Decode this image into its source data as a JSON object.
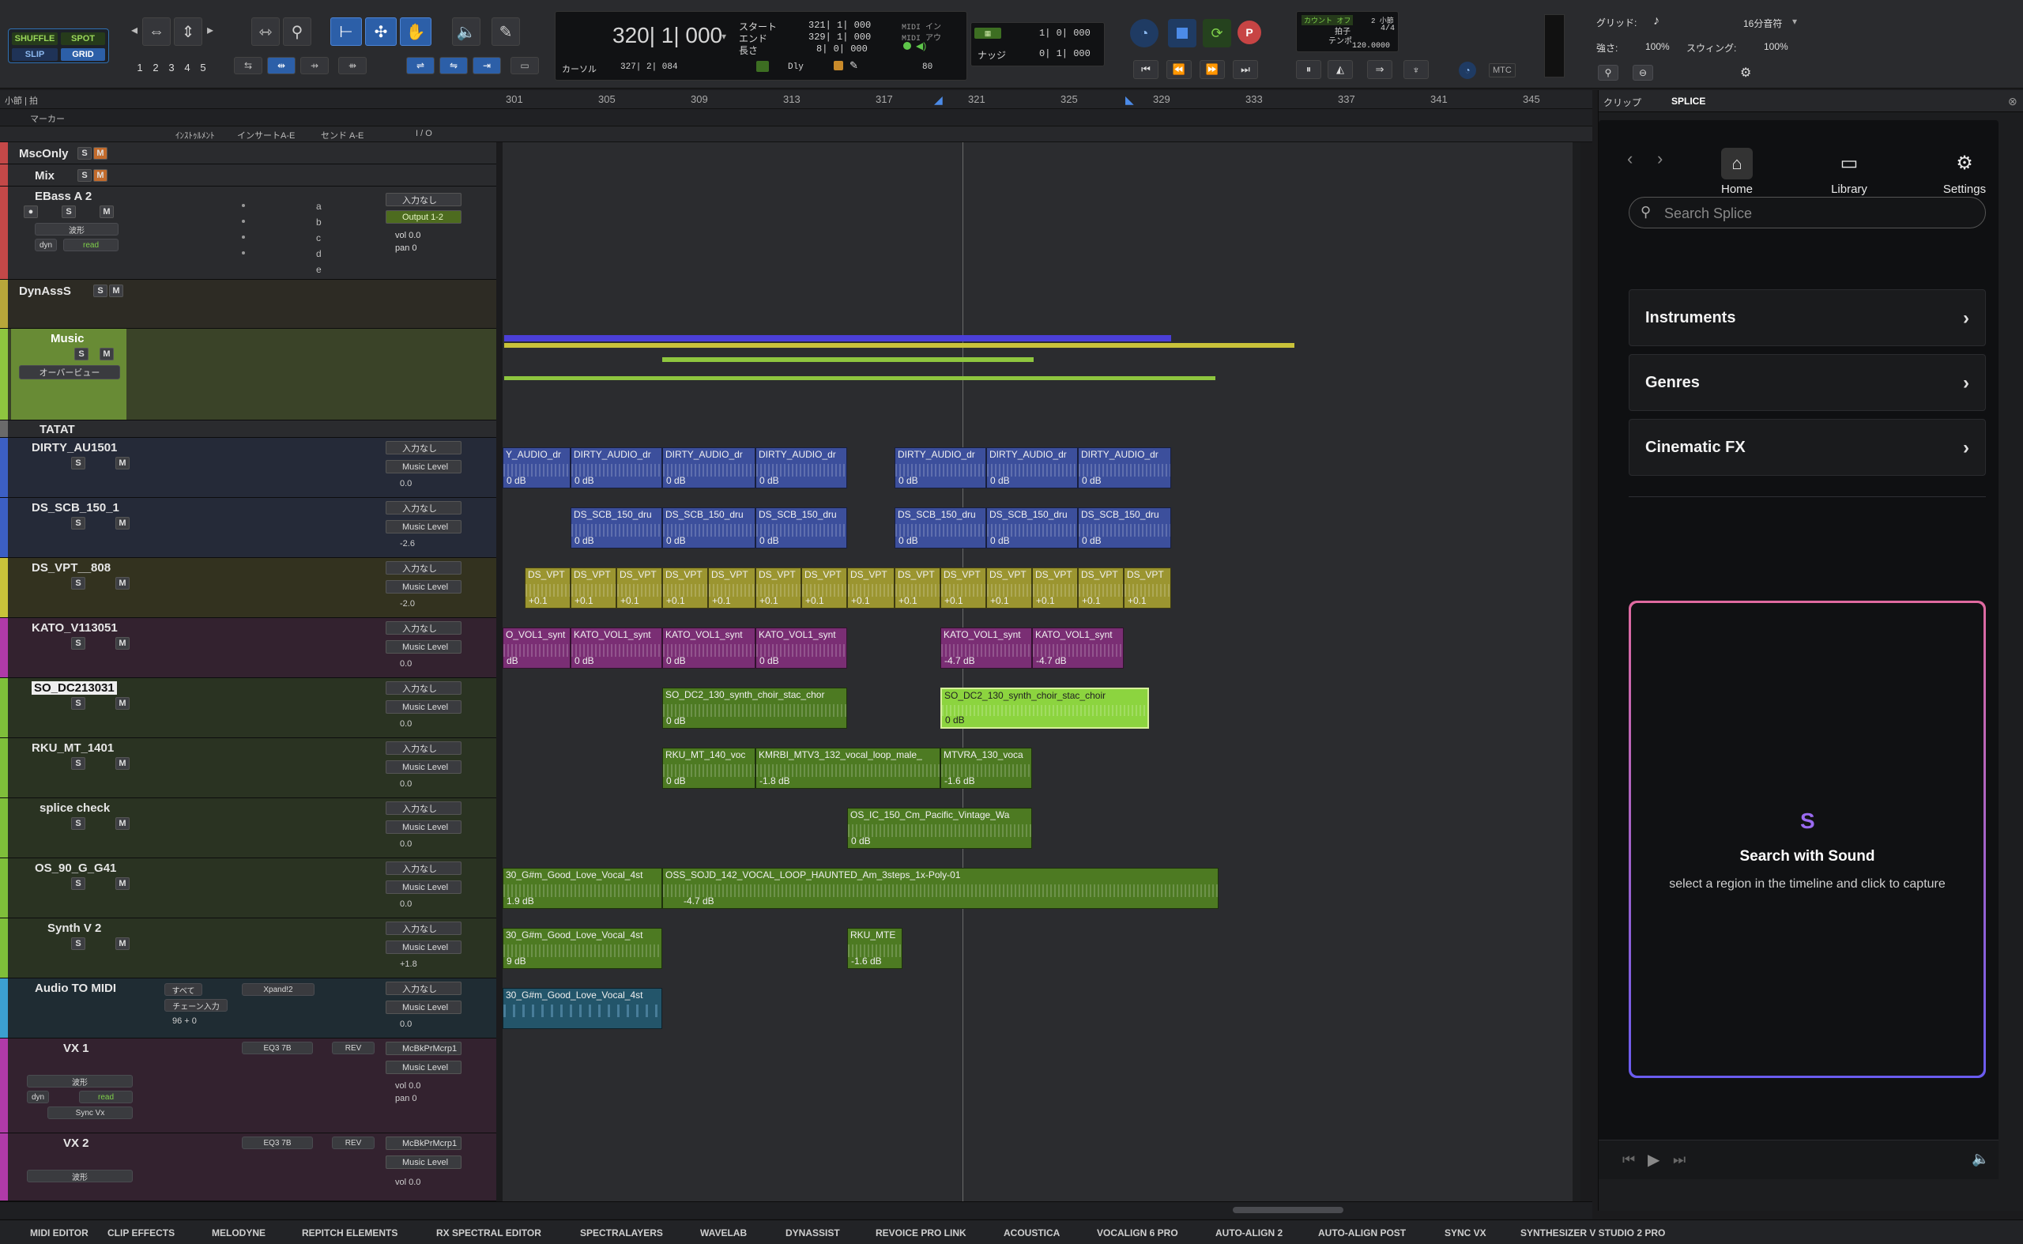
{
  "toolbar": {
    "modes": [
      "SHUFFLE",
      "SPOT",
      "SLIP",
      "GRID"
    ],
    "zoom_presets": [
      "1",
      "2",
      "3",
      "4",
      "5"
    ],
    "main_counter": "320| 1| 000",
    "labels": {
      "start": "スタート",
      "end": "エンド",
      "length": "長さ",
      "cursor": "カーソル"
    },
    "start_value": "321| 1| 000",
    "end_value": "329| 1| 000",
    "length_value": "8| 0| 000",
    "cursor_value": "327| 2| 084",
    "midi_in": "MIDI イン",
    "midi_out": "MIDI アウ",
    "dly_label": "Dly",
    "dly_value": "80",
    "grid_value": "1| 0| 000",
    "nudge_label": "ナッジ",
    "nudge_value": "0| 1| 000",
    "count_off": "カウント オフ",
    "bars2": "2 小節",
    "meter_label": "拍子",
    "meter_value": "4/4",
    "tempo_label": "テンポ",
    "tempo_value": "120.0000",
    "mtc_label": "MTC",
    "grid_label": "グリッド:",
    "grid_note": "16分音符",
    "strength_label": "強さ:",
    "strength_value": "100%",
    "swing_label": "スウィング:",
    "swing_value": "100%"
  },
  "ruler": {
    "timecode_label": "小節 | 拍",
    "marker_label": "マーカー",
    "ticks": [
      "301",
      "305",
      "309",
      "313",
      "317",
      "321",
      "325",
      "329",
      "333",
      "337",
      "341",
      "345"
    ]
  },
  "columns": {
    "instrument": "ｲﾝｽﾄｩﾙﾒﾝﾄ",
    "inserts": "インサートA-E",
    "sends": "センド A-E",
    "io": "I / O"
  },
  "tracks": [
    {
      "name": "MscOnly",
      "color": "#c44848"
    },
    {
      "name": "Mix",
      "color": "#c44848"
    },
    {
      "name": "EBass A 2",
      "color": "#c44848",
      "io": "入力なし",
      "out": "Output 1-2",
      "vol": "0.0",
      "pan": "0",
      "mode1": "波形",
      "mode2": "dyn",
      "mode3": "read",
      "sends": [
        "a",
        "b",
        "c",
        "d",
        "e"
      ]
    },
    {
      "name": "DynAssS",
      "color": "#b8a63a"
    },
    {
      "name": "Music",
      "color": "#8ec63f",
      "sub": "オーバービュー"
    },
    {
      "name": "TATAT",
      "color": "#6a6a6a"
    },
    {
      "name": "DIRTY_AU1501",
      "color": "#3c5fc4",
      "io": "入力なし",
      "out": "Music Level",
      "vol": "0.0"
    },
    {
      "name": "DS_SCB_150_1",
      "color": "#3c5fc4",
      "io": "入力なし",
      "out": "Music Level",
      "vol": "-2.6"
    },
    {
      "name": "DS_VPT__808",
      "color": "#c9c23a",
      "io": "入力なし",
      "out": "Music Level",
      "vol": "-2.0"
    },
    {
      "name": "KATO_V113051",
      "color": "#b03aa8",
      "io": "入力なし",
      "out": "Music Level",
      "vol": "0.0"
    },
    {
      "name": "SO_DC213031",
      "color": "#7fbf3a",
      "io": "入力なし",
      "out": "Music Level",
      "vol": "0.0"
    },
    {
      "name": "RKU_MT_1401",
      "color": "#7fbf3a",
      "io": "入力なし",
      "out": "Music Level",
      "vol": "0.0"
    },
    {
      "name": "splice check",
      "color": "#7fbf3a",
      "io": "入力なし",
      "out": "Music Level",
      "vol": "0.0"
    },
    {
      "name": "OS_90_G_G41",
      "color": "#7fbf3a",
      "io": "入力なし",
      "out": "Music Level",
      "vol": "0.0"
    },
    {
      "name": "Synth V 2",
      "color": "#7fbf3a",
      "io": "入力なし",
      "out": "Music Level",
      "vol": "+1.8"
    },
    {
      "name": "Audio TO MIDI",
      "color": "#3c9fd0",
      "io": "入力なし",
      "out": "Music Level",
      "vol": "0.0",
      "inst": "すべて",
      "plugin": "Xpand!2",
      "chain": "チェーン入力",
      "vel": "96 + 0"
    },
    {
      "name": "VX 1",
      "color": "#b03aa8",
      "ins1": "EQ3 7B",
      "ins2": "REV",
      "io": "McBkPrMcrp1",
      "out": "Music Level",
      "vol": "0.0",
      "pan": "0",
      "mode1": "波形",
      "mode2": "dyn",
      "mode3": "read",
      "mode4": "Sync Vx"
    },
    {
      "name": "VX 2",
      "color": "#b03aa8",
      "ins1": "EQ3 7B",
      "ins2": "REV",
      "io": "McBkPrMcrp1",
      "out": "Music Level",
      "vol": "0.0",
      "mode1": "波形"
    }
  ],
  "clips": {
    "dirty": [
      "Y_AUDIO_dr",
      "DIRTY_AUDIO_dr",
      "DIRTY_AUDIO_dr",
      "DIRTY_AUDIO_dr",
      "DIRTY_AUDIO_dr",
      "DIRTY_AUDIO_dr",
      "DIRTY_AUDIO_dr"
    ],
    "dirty_lvl": "0 dB",
    "dscb": [
      "DS_SCB_150_dru",
      "DS_SCB_150_dru",
      "DS_SCB_150_dru",
      "DS_SCB_150_dru",
      "DS_SCB_150_dru",
      "DS_SCB_150_dru"
    ],
    "dscb_lvl": "0 dB",
    "dsvpt_name": "DS_VPT",
    "dsvpt_lvl": "+0.1",
    "kato": [
      "O_VOL1_synt",
      "KATO_VOL1_synt",
      "KATO_VOL1_synt",
      "KATO_VOL1_synt",
      "KATO_VOL1_synt",
      "KATO_VOL1_synt"
    ],
    "kato_lvls": [
      "dB",
      "0 dB",
      "0 dB",
      "0 dB",
      "-4.7 dB",
      "-4.7 dB"
    ],
    "sodc": [
      "SO_DC2_130_synth_choir_stac_chor",
      "SO_DC2_130_synth_choir_stac_choir"
    ],
    "sodc_lvl": "0 dB",
    "rku": [
      "RKU_MT_140_voc",
      "KMRBI_MTV3_132_vocal_loop_male_",
      "MTVRA_130_voca"
    ],
    "rku_lvls": [
      "0 dB",
      "-1.8 dB",
      "-1.6 dB"
    ],
    "splice": "OS_IC_150_Cm_Pacific_Vintage_Wa",
    "splice_lvl": "0 dB",
    "os90": [
      "30_G#m_Good_Love_Vocal_4st",
      "OSS_SOJD_142_VOCAL_LOOP_HAUNTED_Am_3steps_1x-Poly-01"
    ],
    "os90_lvls": [
      "1.9 dB",
      "-4.7 dB"
    ],
    "synthv": [
      "30_G#m_Good_Love_Vocal_4st",
      "RKU_MTE"
    ],
    "synthv_lvls": [
      "9 dB",
      "-1.6 dB"
    ],
    "audiomidi": "30_G#m_Good_Love_Vocal_4st"
  },
  "splice": {
    "tab_clip": "クリップ",
    "tab_splice": "SPLICE",
    "nav": [
      "Home",
      "Library",
      "Settings"
    ],
    "search_placeholder": "Search Splice",
    "categories": [
      "Instruments",
      "Genres",
      "Cinematic FX"
    ],
    "sws_title": "Search with Sound",
    "sws_desc": "select a region in the timeline and click to capture"
  },
  "bottom_tabs": [
    "MIDI EDITOR",
    "CLIP EFFECTS",
    "MELODYNE",
    "REPITCH ELEMENTS",
    "RX SPECTRAL EDITOR",
    "SPECTRALAYERS",
    "WAVELAB",
    "DYNASSIST",
    "REVOICE PRO LINK",
    "ACOUSTICA",
    "VOCALIGN 6 PRO",
    "AUTO-ALIGN 2",
    "AUTO-ALIGN POST",
    "SYNC VX",
    "SYNTHESIZER V STUDIO 2 PRO"
  ],
  "colors": {
    "accent": "#2c5fa8",
    "music_green": "#8ec63f",
    "splice_gradient_start": "#e06aa0",
    "splice_gradient_end": "#6a5cf0"
  }
}
